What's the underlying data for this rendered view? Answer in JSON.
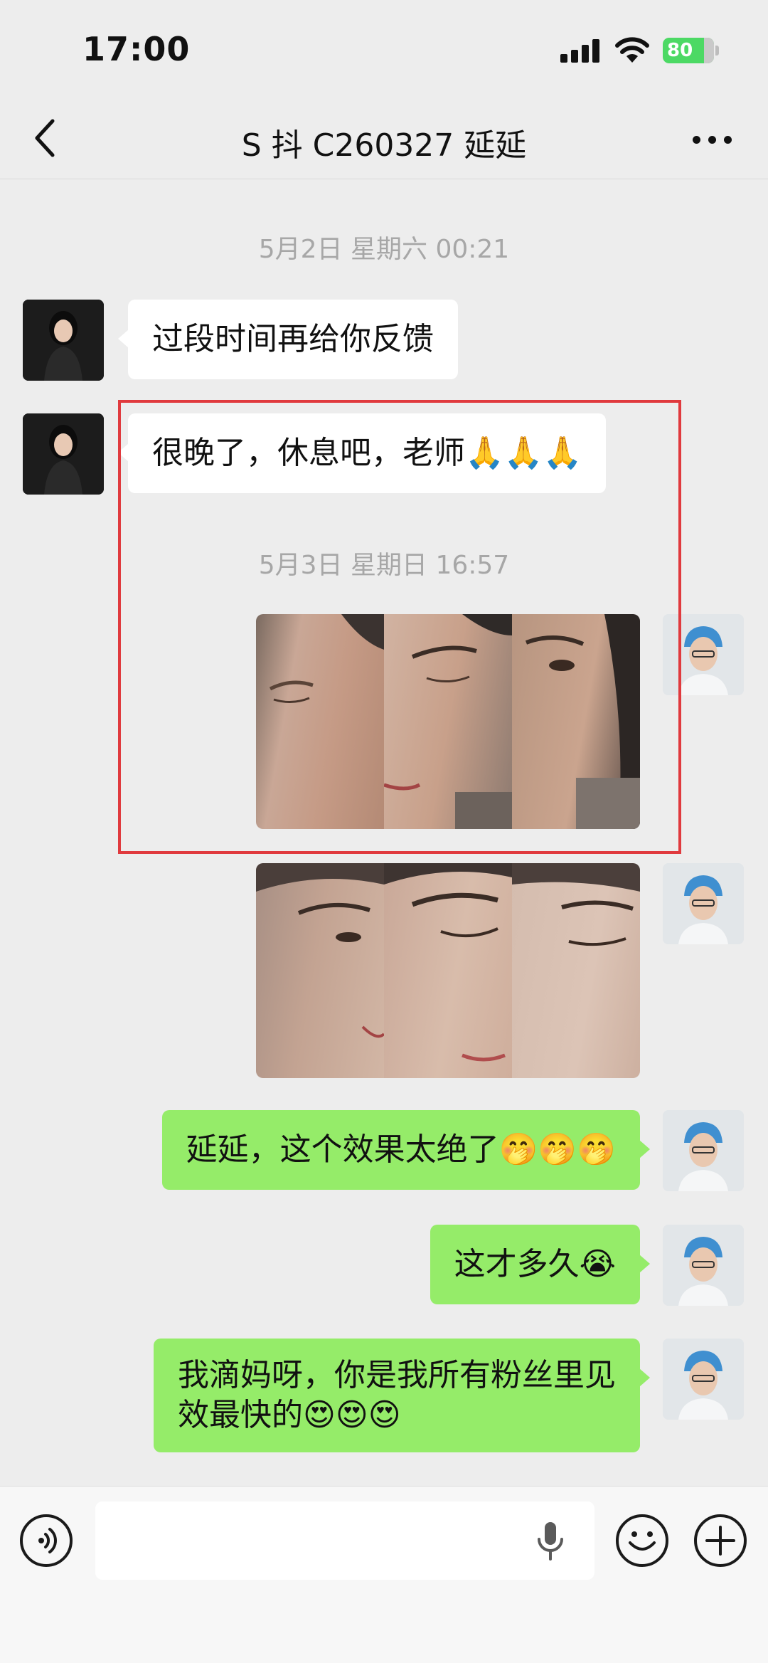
{
  "status_bar": {
    "time": "17:00",
    "battery_level": "80"
  },
  "header": {
    "title": "S 抖 C260327 延延",
    "back_icon": "chevron-left-icon",
    "more_icon": "more-dots-icon"
  },
  "chat": {
    "timestamp_1": "5月2日 星期六 00:21",
    "msg_1": "过段时间再给你反馈",
    "msg_2": "很晚了，休息吧，老师🙏🙏🙏",
    "timestamp_2": "5月3日 星期日 16:57",
    "photo_message_1": "face-photos-before",
    "photo_message_2": "face-photos-after",
    "msg_3": "延延，这个效果太绝了🤭🤭🤭",
    "msg_4": "这才多久😭",
    "msg_5": "我滴妈呀，你是我所有粉丝里见\n效最快的😍😍😍"
  },
  "input_bar": {
    "placeholder": "",
    "voice_icon": "voice-mode-icon",
    "mic_icon": "microphone-icon",
    "emoji_icon": "emoji-icon",
    "plus_icon": "plus-icon"
  },
  "colors": {
    "sent_bubble": "#95ec69",
    "received_bubble": "#ffffff",
    "background": "#ededed",
    "highlight": "#e03a3e"
  }
}
